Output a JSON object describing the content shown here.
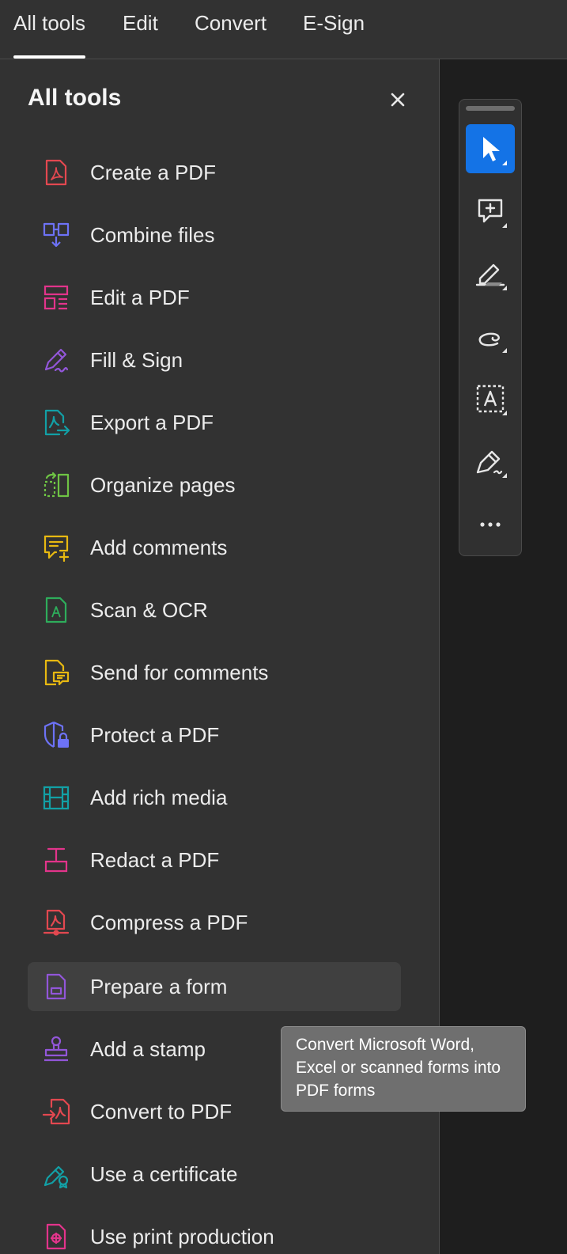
{
  "tabs": [
    {
      "label": "All tools",
      "active": true
    },
    {
      "label": "Edit"
    },
    {
      "label": "Convert"
    },
    {
      "label": "E-Sign"
    }
  ],
  "panel": {
    "title": "All tools",
    "close_icon": "close-icon",
    "tools": [
      {
        "label": "Create a PDF",
        "icon": "create-pdf-icon",
        "color": "#e34850"
      },
      {
        "label": "Combine files",
        "icon": "combine-files-icon",
        "color": "#6d72f6"
      },
      {
        "label": "Edit a PDF",
        "icon": "edit-pdf-icon",
        "color": "#e2348b"
      },
      {
        "label": "Fill & Sign",
        "icon": "fill-sign-icon",
        "color": "#9256d9"
      },
      {
        "label": "Export a PDF",
        "icon": "export-pdf-icon",
        "color": "#12a0a6"
      },
      {
        "label": "Organize pages",
        "icon": "organize-pages-icon",
        "color": "#6ec344"
      },
      {
        "label": "Add comments",
        "icon": "add-comments-icon",
        "color": "#e8b911"
      },
      {
        "label": "Scan & OCR",
        "icon": "scan-ocr-icon",
        "color": "#2ead5b"
      },
      {
        "label": "Send for comments",
        "icon": "send-for-comments-icon",
        "color": "#e8b911"
      },
      {
        "label": "Protect a PDF",
        "icon": "protect-pdf-icon",
        "color": "#6d72f6"
      },
      {
        "label": "Add rich media",
        "icon": "rich-media-icon",
        "color": "#12a0a6"
      },
      {
        "label": "Redact a PDF",
        "icon": "redact-pdf-icon",
        "color": "#e2348b"
      },
      {
        "label": "Compress a PDF",
        "icon": "compress-pdf-icon",
        "color": "#e34850"
      },
      {
        "label": "Prepare a form",
        "icon": "prepare-form-icon",
        "color": "#9256d9",
        "highlighted": true
      },
      {
        "label": "Add a stamp",
        "icon": "stamp-icon",
        "color": "#9256d9"
      },
      {
        "label": "Convert to PDF",
        "icon": "convert-to-pdf-icon",
        "color": "#e34850"
      },
      {
        "label": "Use a certificate",
        "icon": "certificate-icon",
        "color": "#12a0a6"
      },
      {
        "label": "Use print production",
        "icon": "print-production-icon",
        "color": "#e2348b"
      }
    ]
  },
  "quick_tools": [
    {
      "name": "select-tool",
      "icon": "cursor-icon",
      "selected": true
    },
    {
      "name": "add-comment-tool",
      "icon": "comment-add-icon"
    },
    {
      "name": "highlight-tool",
      "icon": "highlighter-icon"
    },
    {
      "name": "draw-tool",
      "icon": "freehand-draw-icon"
    },
    {
      "name": "text-select-tool",
      "icon": "text-box-icon"
    },
    {
      "name": "sign-tool",
      "icon": "pen-sign-icon"
    },
    {
      "name": "more-tool",
      "icon": "more-icon"
    }
  ],
  "tooltip": {
    "text": "Convert Microsoft Word, Excel or scanned forms into PDF forms"
  },
  "colors": {
    "accent": "#1473e6",
    "panel_bg": "#323232",
    "canvas_bg": "#1e1e1e"
  }
}
